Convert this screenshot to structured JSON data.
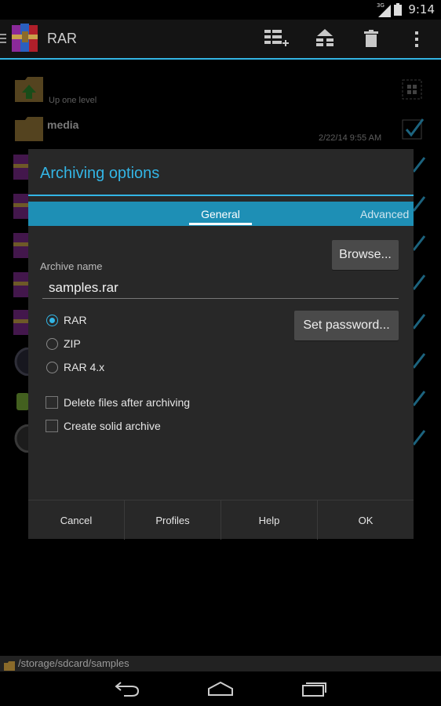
{
  "status": {
    "time": "9:14",
    "network": "3G"
  },
  "app": {
    "title": "RAR"
  },
  "file_list": {
    "up_one_level": "Up one level",
    "items": [
      {
        "name": "media",
        "date": "2/22/14 9:55 AM",
        "checked": true
      }
    ]
  },
  "dialog": {
    "title": "Archiving options",
    "tabs": [
      "General",
      "Advanced"
    ],
    "active_tab": "General",
    "archive_name_label": "Archive name",
    "archive_name_value": "samples.rar",
    "browse_label": "Browse...",
    "set_password_label": "Set password...",
    "formats": [
      "RAR",
      "ZIP",
      "RAR 4.x"
    ],
    "selected_format": "RAR",
    "options": [
      "Delete files after archiving",
      "Create solid archive"
    ],
    "buttons": [
      "Cancel",
      "Profiles",
      "Help",
      "OK"
    ]
  },
  "path": "/storage/sdcard/samples",
  "colors": {
    "accent": "#33b5e5",
    "tab_bar": "#1e8fb5",
    "dialog_bg": "#282828"
  }
}
